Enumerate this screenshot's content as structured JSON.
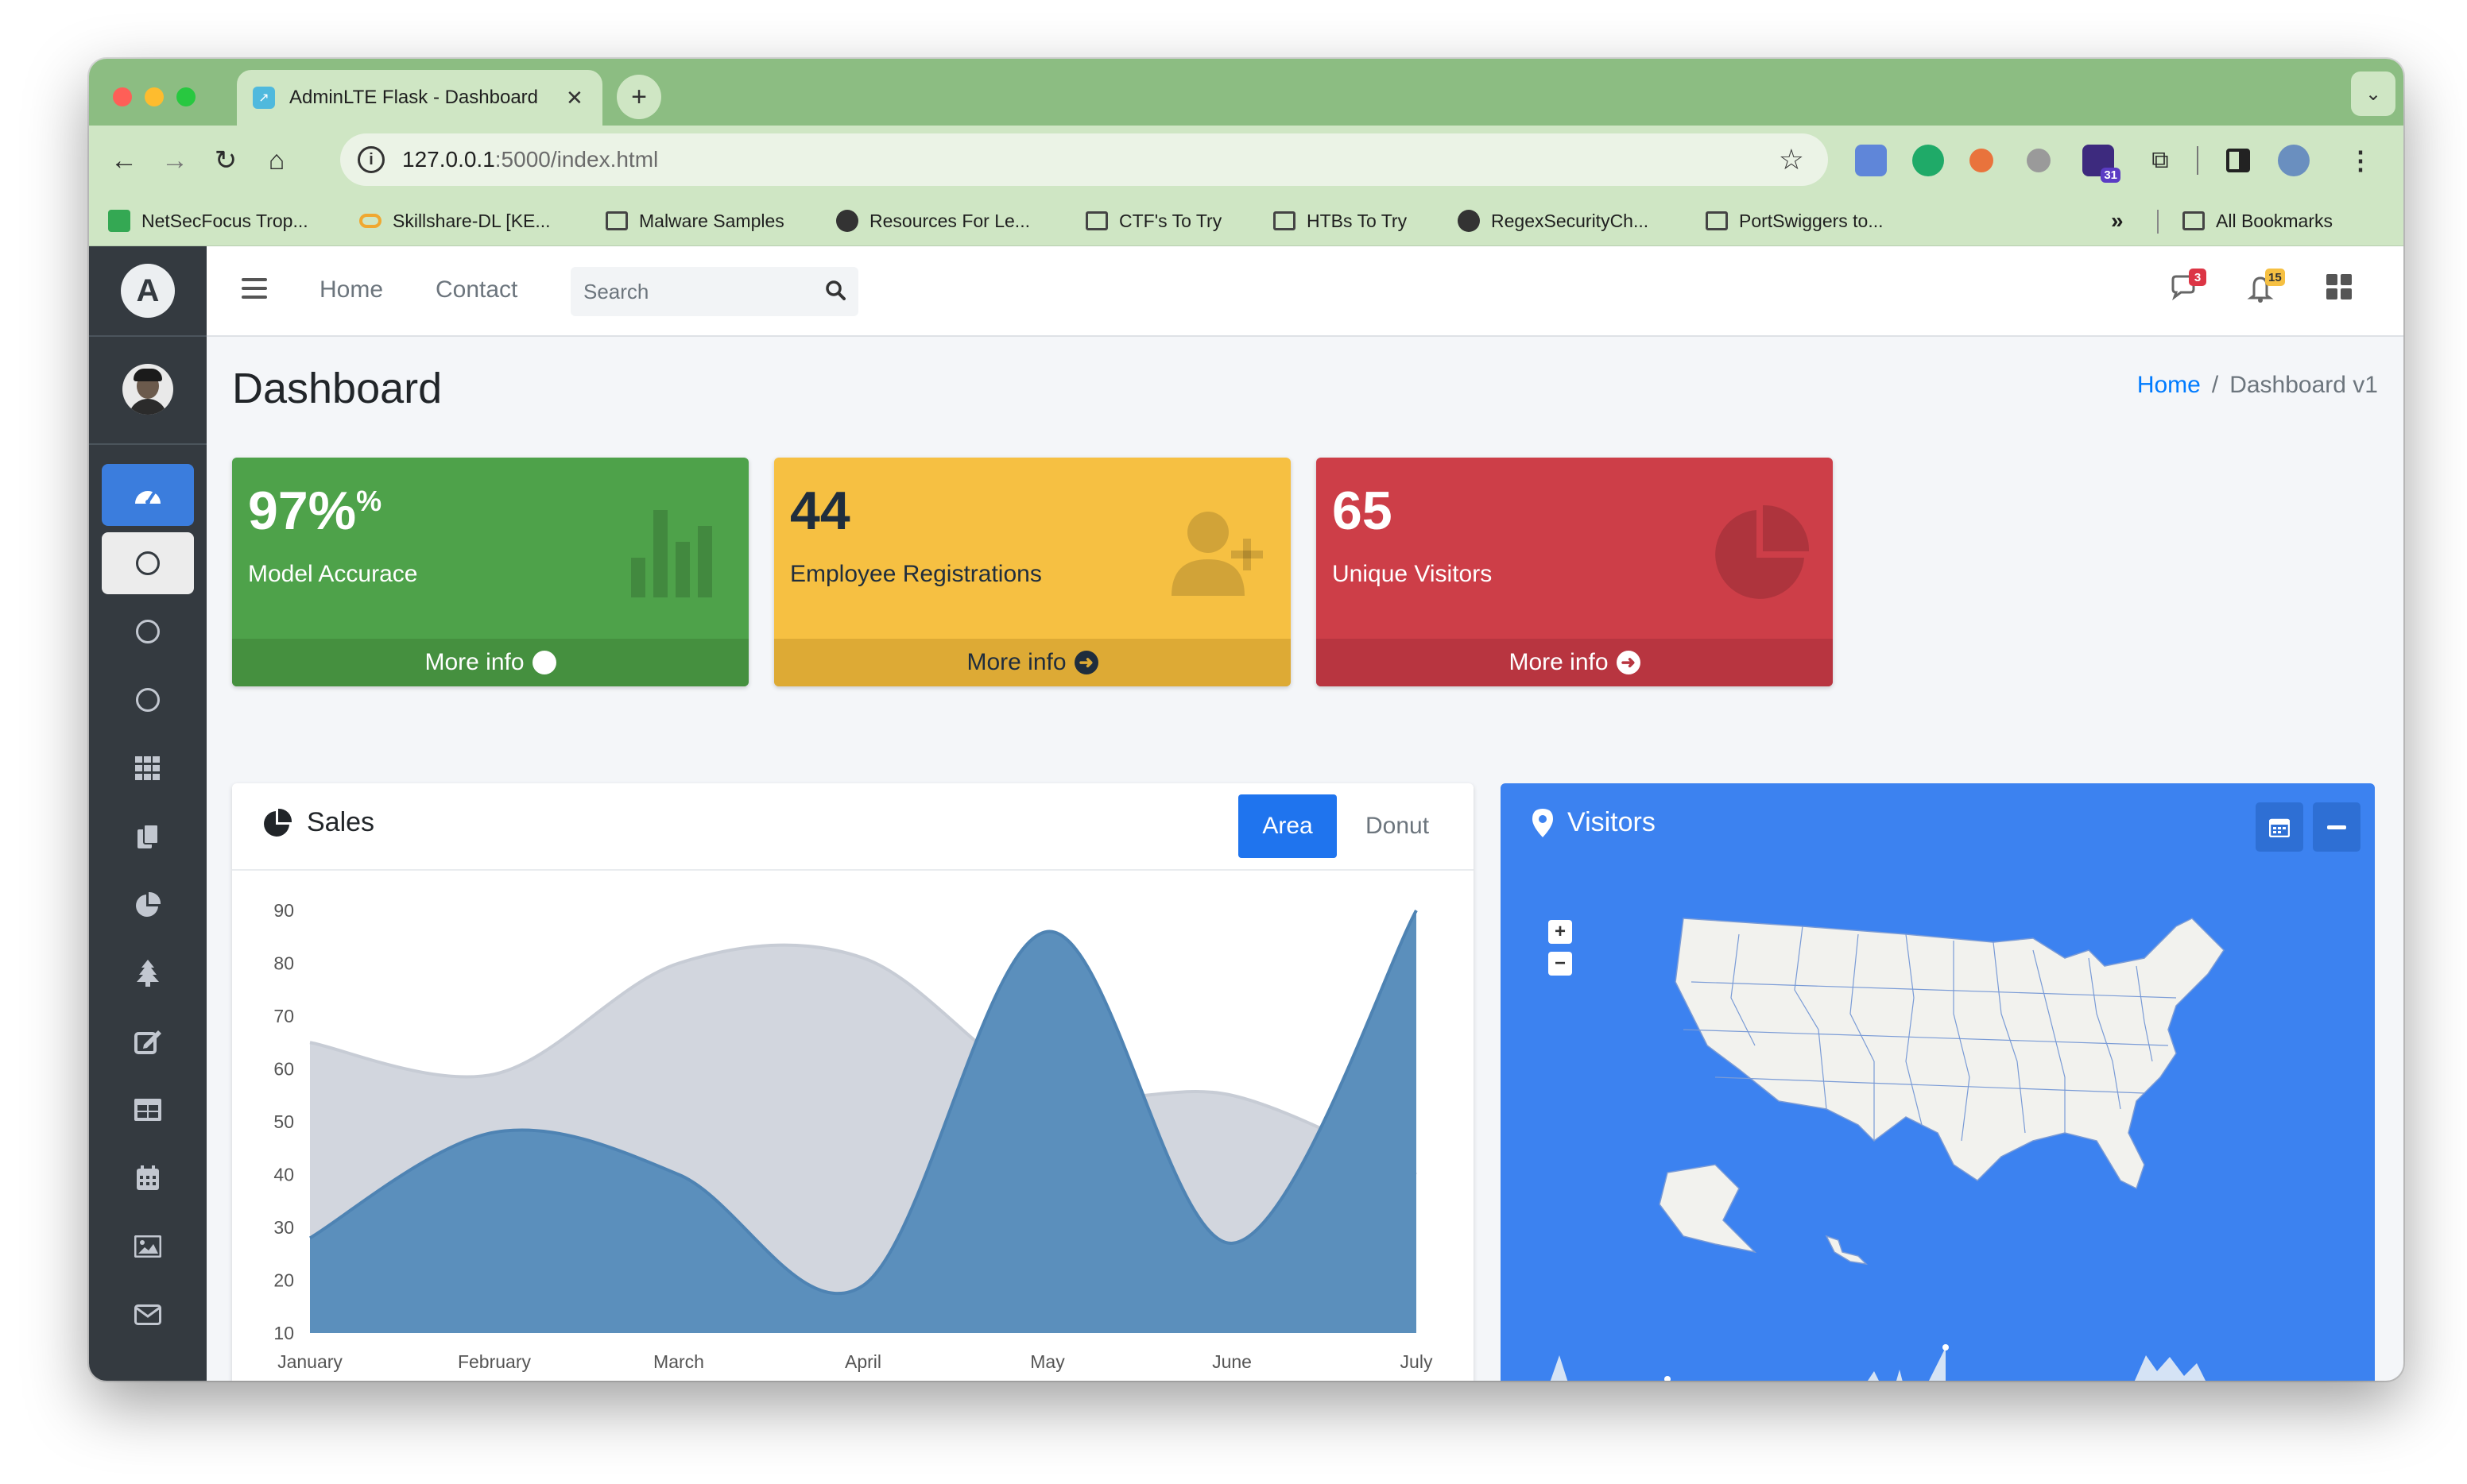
{
  "browser": {
    "tab_title": "AdminLTE Flask - Dashboard",
    "url_host": "127.0.0.1",
    "url_path": ":5000/index.html",
    "bookmarks": [
      "NetSecFocus Trop...",
      "Skillshare-DL [KE...",
      "Malware Samples",
      "Resources For Le...",
      "CTF's To Try",
      "HTBs To Try",
      "RegexSecurityCh...",
      "PortSwiggers to..."
    ],
    "overflow": "»",
    "all_bookmarks": "All Bookmarks",
    "ext_badge": "31"
  },
  "navbar": {
    "links": [
      "Home",
      "Contact"
    ],
    "search_placeholder": "Search",
    "messages_count": "3",
    "notifications_count": "15"
  },
  "page": {
    "title": "Dashboard",
    "breadcrumb": {
      "home": "Home",
      "separator": "/",
      "current": "Dashboard v1"
    }
  },
  "boxes": [
    {
      "value": "97%",
      "sup": "%",
      "label": "Model Accurace",
      "footer": "More info",
      "color": "#4ea24a",
      "footer_color": "#45903f"
    },
    {
      "value": "44",
      "sup": "",
      "label": "Employee Registrations",
      "footer": "More info",
      "color": "#f6c042",
      "footer_color": "#ddaa35"
    },
    {
      "value": "65",
      "sup": "",
      "label": "Unique Visitors",
      "footer": "More info",
      "color": "#cd3e48",
      "footer_color": "#b83540"
    }
  ],
  "sales": {
    "title": "Sales",
    "buttons": [
      "Area",
      "Donut"
    ],
    "active_button": "Area"
  },
  "visitors": {
    "title": "Visitors"
  },
  "chart_data": {
    "type": "area",
    "categories": [
      "January",
      "February",
      "March",
      "April",
      "May",
      "June",
      "July"
    ],
    "y_ticks": [
      10,
      20,
      30,
      40,
      50,
      60,
      70,
      80,
      90
    ],
    "ylim": [
      10,
      90
    ],
    "series": [
      {
        "values": [
          65,
          59,
          80,
          81,
          56,
          55,
          40
        ],
        "color": "#d2d6de"
      },
      {
        "values": [
          28,
          48,
          40,
          19,
          86,
          27,
          90
        ],
        "color": "#5b8fbc"
      }
    ],
    "grid": false,
    "legend": "none"
  },
  "colors": {
    "sidebar": "#343a40",
    "sidebar_active": "#3b7ddd",
    "visitors_card": "#3c82f0",
    "chrome_tabstrip": "#8cbd82",
    "chrome_toolbar": "#cfe6c4",
    "link": "#007bff"
  },
  "icons": {
    "sidebar": [
      "tachometer-icon",
      "circle-icon",
      "circle-icon",
      "circle-icon",
      "grid-icon",
      "copy-icon",
      "chart-pie-icon",
      "tree-icon",
      "edit-icon",
      "table-icon",
      "calendar-icon",
      "image-icon",
      "envelope-icon"
    ]
  }
}
